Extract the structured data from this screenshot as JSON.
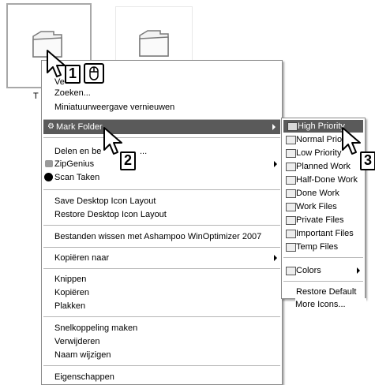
{
  "desktop": {
    "folder_label_fragment": "T"
  },
  "context_menu": {
    "items_top": [
      {
        "label": "Ve"
      },
      {
        "label": "Zoeken..."
      },
      {
        "label": "Miniatuurweergave vernieuwen"
      }
    ],
    "mark_folder": "Mark Folder",
    "delen": "Delen en be",
    "delen_suffix": "...",
    "zipgenius": "ZipGenius",
    "scan": "Scan Taken",
    "save_layout": "Save Desktop Icon Layout",
    "restore_layout": "Restore Desktop Icon Layout",
    "ashampoo": "Bestanden wissen met Ashampoo WinOptimizer 2007",
    "kopieren_naar": "Kopiëren naar",
    "knippen": "Knippen",
    "kopieren": "Kopiëren",
    "plakken": "Plakken",
    "snelkoppeling": "Snelkoppeling maken",
    "verwijderen": "Verwijderen",
    "naam_wijzigen": "Naam wijzigen",
    "eigenschappen": "Eigenschappen"
  },
  "submenu": {
    "items": [
      {
        "label": "High Priority",
        "color": "#5a5a5a"
      },
      {
        "label": "Normal Prio",
        "color": "#d8d8d8"
      },
      {
        "label": "Low Priority",
        "color": "#d8d8d8"
      },
      {
        "label": "Planned Work",
        "color": "#d8d8d8"
      },
      {
        "label": "Half-Done Work",
        "color": "#d8d8d8"
      },
      {
        "label": "Done Work",
        "color": "#d8d8d8"
      },
      {
        "label": "Work Files",
        "color": "#d8d8d8"
      },
      {
        "label": "Private Files",
        "color": "#d8d8d8"
      },
      {
        "label": "Important Files",
        "color": "#d8d8d8"
      },
      {
        "label": "Temp Files",
        "color": "#d8d8d8"
      }
    ],
    "colors": "Colors",
    "restore_default": "Restore Default",
    "more_icons": "More Icons..."
  },
  "callouts": {
    "one": "1",
    "two": "2",
    "three": "3"
  },
  "icons": {
    "folder": "folder-icon",
    "mouse": "mouse-icon",
    "cursor": "arrow-cursor-icon"
  }
}
